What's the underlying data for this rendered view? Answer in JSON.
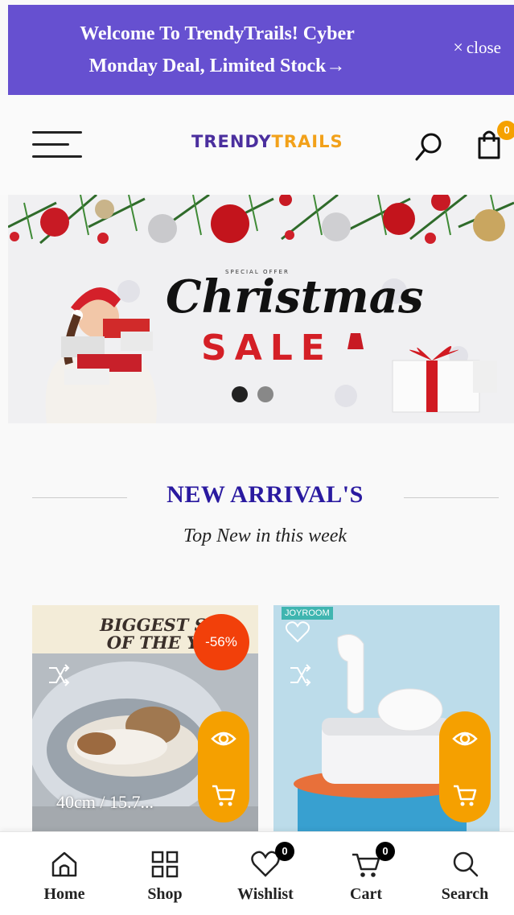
{
  "announcement": {
    "text": "Welcome To TrendyTrails! Cyber Monday Deal, Limited Stock→",
    "close_icon": "×",
    "close_label": "close",
    "background": "#6650d0"
  },
  "header": {
    "logo_part1": "TRENDY",
    "logo_part2": "TRAILS",
    "cart_count": "0",
    "menu_icon": "hamburger-icon",
    "search_icon": "search-icon",
    "cart_icon": "shopping-bag-icon"
  },
  "hero": {
    "kicker": "SPECIAL OFFER",
    "title": "Christmas",
    "subtitle": "SALE",
    "slides": 2,
    "active_slide": 1
  },
  "section": {
    "title": "NEW ARRIVAL'S",
    "subtitle": "Top New in this week"
  },
  "products": [
    {
      "promo_line1": "BIGGEST SAL",
      "promo_line2": "OF THE YEA",
      "discount": "-56%",
      "title": "40cm / 15.7..."
    },
    {
      "brand": "JOYROOM",
      "title": ""
    }
  ],
  "bottom_nav": {
    "items": [
      {
        "label": "Home",
        "icon": "home-icon"
      },
      {
        "label": "Shop",
        "icon": "grid-icon"
      },
      {
        "label": "Wishlist",
        "icon": "heart-icon",
        "badge": "0"
      },
      {
        "label": "Cart",
        "icon": "cart-icon",
        "badge": "0"
      },
      {
        "label": "Search",
        "icon": "search-icon"
      }
    ]
  },
  "colors": {
    "accent_purple": "#6650d0",
    "heading_blue": "#2a1aa0",
    "orange": "#f5a000",
    "discount_red": "#f2400a"
  }
}
